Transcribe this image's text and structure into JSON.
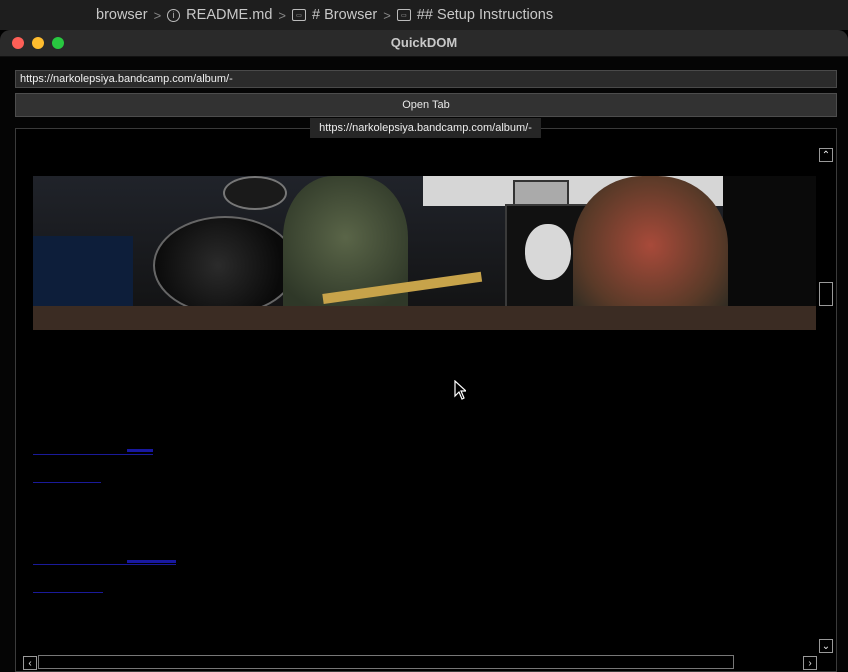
{
  "breadcrumb": {
    "items": [
      "browser",
      "README.md",
      "# Browser",
      "## Setup Instructions"
    ]
  },
  "window": {
    "title": "QuickDOM"
  },
  "toolbar": {
    "url_value": "https://narkolepsiya.bandcamp.com/album/-",
    "open_tab_label": "Open Tab"
  },
  "tab": {
    "label": "https://narkolepsiya.bandcamp.com/album/-"
  },
  "scrollbars": {
    "up_glyph": "⌃",
    "down_glyph": "⌄",
    "left_glyph": "‹",
    "right_glyph": "›"
  },
  "colors": {
    "link": "#1c1caa",
    "close": "#fe5f57",
    "minimize": "#febc2e",
    "maximize": "#28c840"
  }
}
